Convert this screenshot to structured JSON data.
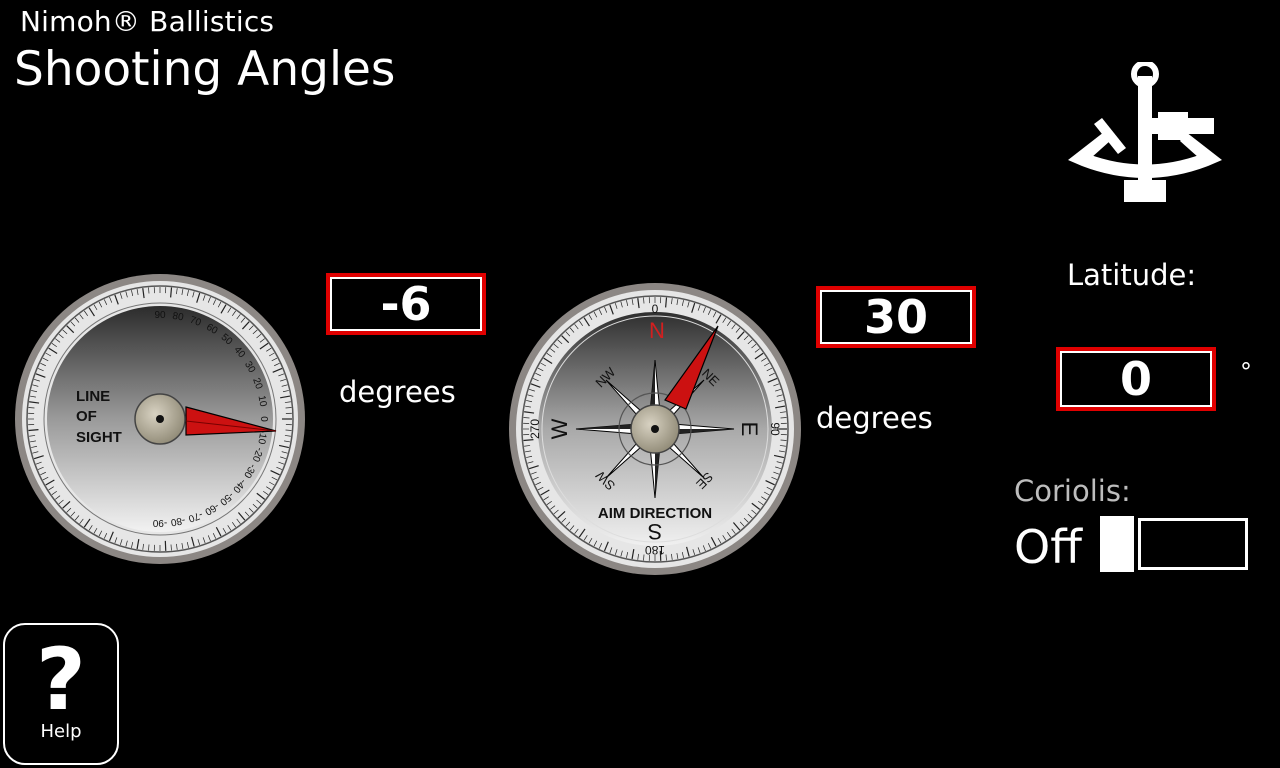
{
  "app_title": "Nimoh® Ballistics",
  "page_title": "Shooting Angles",
  "line_of_sight": {
    "dial_label_lines": [
      "LINE",
      "OF",
      "SIGHT"
    ],
    "ticks_up": [
      "90",
      "80",
      "70",
      "60",
      "50",
      "40",
      "30",
      "20",
      "10",
      "0"
    ],
    "ticks_down": [
      "-10",
      "-20",
      "-30",
      "-40",
      "-50",
      "-60",
      "-70",
      "-80",
      "-90"
    ],
    "value": "-6",
    "unit_label": "degrees",
    "needle_color": "#cc1111"
  },
  "aim_direction": {
    "dial_label": "AIM DIRECTION",
    "cardinals": {
      "n": "N",
      "e": "E",
      "s": "S",
      "w": "W"
    },
    "intercardinals": {
      "ne": "NE",
      "nw": "NW",
      "se": "SE",
      "sw": "SW"
    },
    "degree_marks": {
      "n": "0",
      "e": "90",
      "s": "180",
      "w": "270"
    },
    "value": "30",
    "unit_label": "degrees",
    "north_color": "#d21f1f"
  },
  "latitude": {
    "label": "Latitude:",
    "value": "0",
    "unit": "°"
  },
  "coriolis": {
    "label": "Coriolis:",
    "state": "Off",
    "enabled": false
  },
  "help": {
    "icon_glyph": "?",
    "label": "Help"
  },
  "icons": {
    "sextant": "sextant-icon",
    "help": "question-mark-icon"
  },
  "colors": {
    "accent_red": "#e00000",
    "background": "#000000",
    "text": "#ffffff",
    "muted_text": "#bdbdbd"
  }
}
